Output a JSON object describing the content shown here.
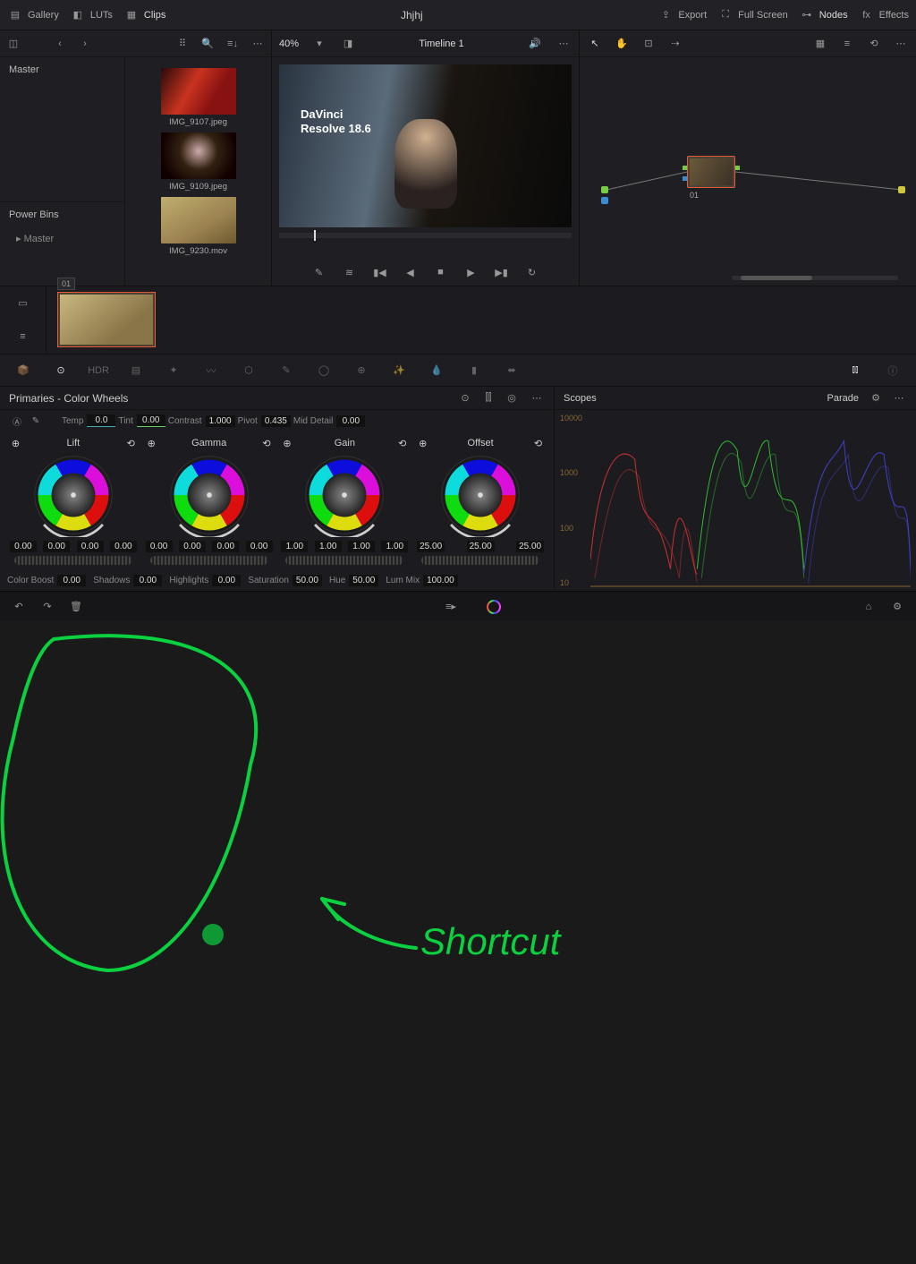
{
  "topbar": {
    "gallery": "Gallery",
    "luts": "LUTs",
    "clips": "Clips",
    "project": "Jhjhj",
    "export": "Export",
    "fullscreen": "Full Screen",
    "nodes": "Nodes",
    "effects": "Effects"
  },
  "mediapool": {
    "master": "Master",
    "powerbins": "Power Bins",
    "sub_master": "Master",
    "thumbs": [
      {
        "label": "IMG_9107.jpeg"
      },
      {
        "label": "IMG_9109.jpeg"
      },
      {
        "label": "IMG_9230.mov"
      }
    ]
  },
  "viewer": {
    "zoom": "40%",
    "timeline": "Timeline 1",
    "overlay_l1": "DaVinci",
    "overlay_l2": "Resolve 18.6"
  },
  "nodes": {
    "node1": "01"
  },
  "timeline": {
    "clip": "01"
  },
  "wheels_panel": {
    "title": "Primaries - Color Wheels",
    "temp_lbl": "Temp",
    "temp_val": "0.0",
    "tint_lbl": "Tint",
    "tint_val": "0.00",
    "contrast_lbl": "Contrast",
    "contrast_val": "1.000",
    "pivot_lbl": "Pivot",
    "pivot_val": "0.435",
    "middetail_lbl": "Mid Detail",
    "middetail_val": "0.00",
    "wheels": [
      {
        "name": "Lift",
        "v": [
          "0.00",
          "0.00",
          "0.00",
          "0.00"
        ]
      },
      {
        "name": "Gamma",
        "v": [
          "0.00",
          "0.00",
          "0.00",
          "0.00"
        ]
      },
      {
        "name": "Gain",
        "v": [
          "1.00",
          "1.00",
          "1.00",
          "1.00"
        ]
      },
      {
        "name": "Offset",
        "v": [
          "25.00",
          "25.00",
          "25.00"
        ]
      }
    ],
    "colorboost_lbl": "Color Boost",
    "colorboost_val": "0.00",
    "shadows_lbl": "Shadows",
    "shadows_val": "0.00",
    "highlights_lbl": "Highlights",
    "highlights_val": "0.00",
    "saturation_lbl": "Saturation",
    "saturation_val": "50.00",
    "hue_lbl": "Hue",
    "hue_val": "50.00",
    "lummix_lbl": "Lum Mix",
    "lummix_val": "100.00"
  },
  "scopes": {
    "title": "Scopes",
    "mode": "Parade",
    "ticks": [
      "10000",
      "1000",
      "100",
      "10"
    ]
  },
  "annotation": {
    "text": "Shortcut"
  }
}
